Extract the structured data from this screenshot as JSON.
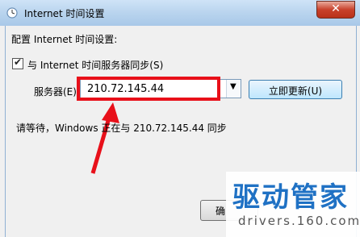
{
  "window": {
    "title": "Internet 时间设置",
    "close_symbol": "✕"
  },
  "content": {
    "heading": "配置 Internet 时间设置:",
    "sync_checkbox": {
      "checked": true,
      "label": "与 Internet 时间服务器同步(S)"
    },
    "server_label": "服务器(E):",
    "server_value": "210.72.145.44",
    "update_button": "立即更新(U)",
    "status_text": "请等待，Windows 正在与 210.72.145.44 同步",
    "ok_button": "确"
  },
  "watermark": {
    "brand": "驱动管家",
    "url": "drivers.160.com"
  },
  "colors": {
    "highlight_box": "#e8101a",
    "brand": "#1f71c4"
  }
}
